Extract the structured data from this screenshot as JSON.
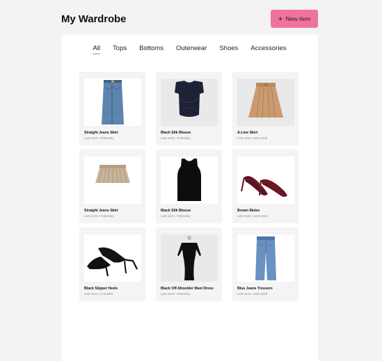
{
  "header": {
    "title": "My Wardrobe",
    "new_item_label": "New Item",
    "accent_color": "#f0739b"
  },
  "tabs": [
    {
      "label": "All",
      "active": true
    },
    {
      "label": "Tops",
      "active": false
    },
    {
      "label": "Bottoms",
      "active": false
    },
    {
      "label": "Outerwear",
      "active": false
    },
    {
      "label": "Shoes",
      "active": false
    },
    {
      "label": "Accessories",
      "active": false
    }
  ],
  "items": [
    {
      "name": "Straight Jeans Skirt",
      "worn": "Last worn: Yesterday",
      "icon": "denim-skirt-image"
    },
    {
      "name": "Black Silk Blouse",
      "worn": "Last worn: Yesterday",
      "icon": "navy-blouse-image"
    },
    {
      "name": "A-Line Skirt",
      "worn": "Last worn: Last week",
      "icon": "camel-skirt-image"
    },
    {
      "name": "Straight Jeans Skirt",
      "worn": "Last worn: Yesterday",
      "icon": "pleated-mini-skirt-image"
    },
    {
      "name": "Black Silk Blouse",
      "worn": "Last worn: Yesterday",
      "icon": "black-tank-top-image"
    },
    {
      "name": "Brown Mules",
      "worn": "Last worn: Last week",
      "icon": "burgundy-heels-image"
    },
    {
      "name": "Black Slipper Heels",
      "worn": "Last worn: 2 months",
      "icon": "black-heels-image"
    },
    {
      "name": "Black Off-Shoulder Maxi Dress",
      "worn": "Last worn: Yesterday",
      "icon": "black-maxi-dress-image"
    },
    {
      "name": "Blue Jeans Trousers",
      "worn": "Last worn: Last week",
      "icon": "blue-jeans-image"
    }
  ]
}
